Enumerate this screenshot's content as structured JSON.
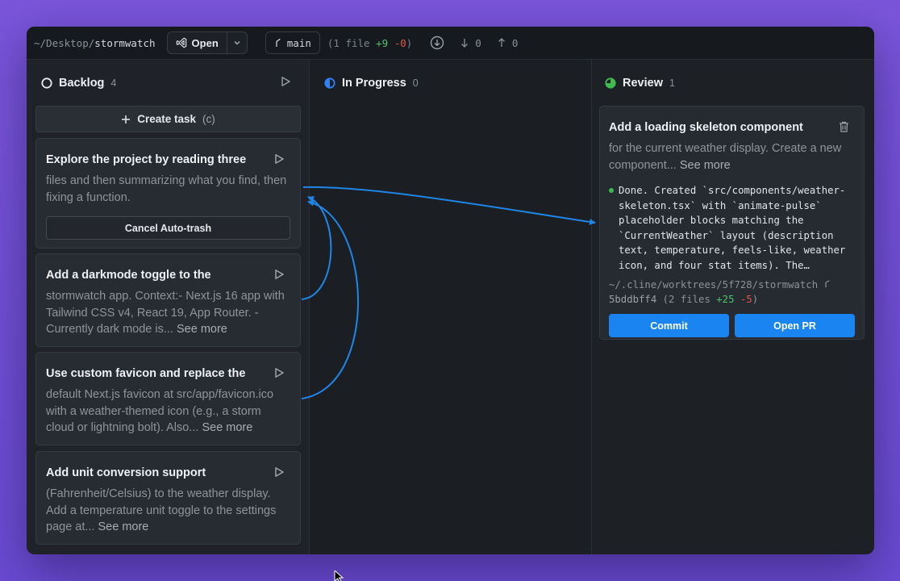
{
  "topbar": {
    "path_prefix": "~/Desktop/",
    "path_project": "stormwatch",
    "open_label": "Open",
    "branch": "main",
    "changes_prefix": "(1 file",
    "changes_plus": "+9",
    "changes_minus": "-0",
    "changes_suffix": ")",
    "behind": "0",
    "ahead": "0"
  },
  "columns": [
    {
      "title": "Backlog",
      "count": "4"
    },
    {
      "title": "In Progress",
      "count": "0"
    },
    {
      "title": "Review",
      "count": "1"
    }
  ],
  "backlog": {
    "create_label": "Create task",
    "create_hint": "(c)",
    "cards": [
      {
        "title": "Explore the project by reading three",
        "desc": "files and then summarizing what you find, then fixing a function.",
        "more": "",
        "action": "Cancel Auto-trash"
      },
      {
        "title": "Add a darkmode toggle to the",
        "desc": "stormwatch app. Context:- Next.js 16 app with Tailwind CSS v4, React 19, App Router. - Currently dark mode is...",
        "more": "See more"
      },
      {
        "title": "Use custom favicon and replace the",
        "desc": "default Next.js favicon at src/app/favicon.ico with a weather-themed icon (e.g., a storm cloud or lightning bolt). Also...",
        "more": "See more"
      },
      {
        "title": "Add unit conversion support",
        "desc": "(Fahrenheit/Celsius) to the weather display. Add a temperature unit toggle to the settings page at...",
        "more": "See more"
      }
    ]
  },
  "review": {
    "card": {
      "title": "Add a loading skeleton component",
      "desc": "for the current weather display. Create a new component...",
      "more": "See more",
      "log_lines": [
        "Done. Created `src/components/weather-",
        "skeleton.tsx` with `animate-pulse`",
        "placeholder blocks matching the",
        "`CurrentWeather` layout (description",
        "text, temperature, feels-like, weather",
        "icon, and four stat items). The…"
      ],
      "worktree": "~/.cline/worktrees/5f728/stormwatch",
      "commit_hash": "5bddbff4",
      "files_prefix": "(2 files",
      "files_plus": "+25",
      "files_minus": "-5",
      "files_suffix": ")",
      "commit_label": "Commit",
      "pr_label": "Open PR"
    }
  },
  "colors": {
    "accent": "#1a85f0",
    "in_progress_icon": "#2f81f7",
    "review_icon": "#3fb950",
    "arrow": "#1f86e8"
  }
}
